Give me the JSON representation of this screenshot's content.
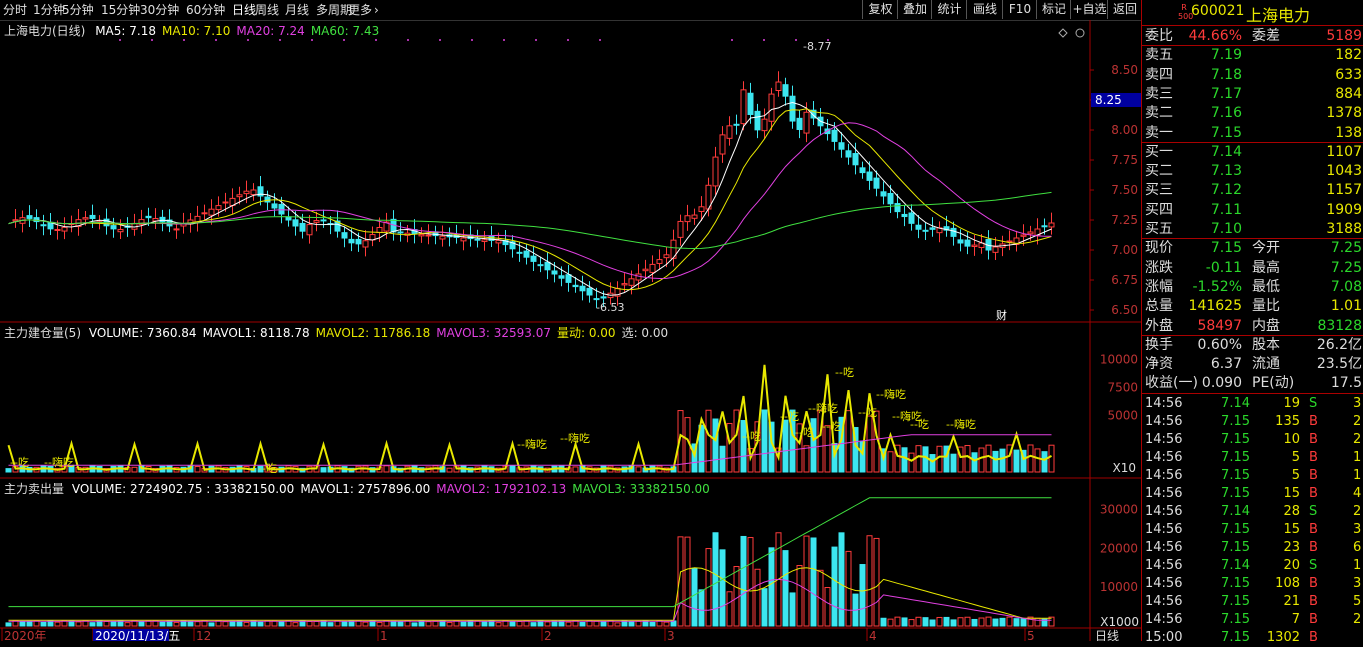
{
  "toolbar": {
    "periods": [
      "分时",
      "1分钟",
      "5分钟",
      "15分钟",
      "30分钟",
      "60分钟",
      "日线",
      "周线",
      "月线",
      "多周期",
      "更多"
    ],
    "active_period": "日线",
    "right_buttons": [
      "复权",
      "叠加",
      "统计",
      "画线",
      "F10",
      "标记",
      "+自选",
      "返回"
    ]
  },
  "stock": {
    "badge_top": "R",
    "badge_bottom": "500",
    "code": "600021",
    "name": "上海电力"
  },
  "main_chart": {
    "title": "上海电力(日线)",
    "ma": [
      {
        "label": "MA5: 7.18",
        "color": "#ffffff"
      },
      {
        "label": "MA10: 7.10",
        "color": "#e8e800"
      },
      {
        "label": "MA20: 7.24",
        "color": "#e040e0"
      },
      {
        "label": "MA60: 7.43",
        "color": "#40e040"
      }
    ],
    "high_label": "8.77",
    "low_label": "6.53",
    "current_price_tag": "8.25",
    "cai_marker": "财"
  },
  "sub1": {
    "title": "主力建仓量(5)",
    "items": [
      {
        "label": "VOLUME: 7360.84",
        "color": "#ffffff"
      },
      {
        "label": "MAVOL1: 8118.78",
        "color": "#ffffff"
      },
      {
        "label": "MAVOL2: 11786.18",
        "color": "#e8e800"
      },
      {
        "label": "MAVOL3: 32593.07",
        "color": "#e040e0"
      },
      {
        "label": "量动: 0.00",
        "color": "#e8e800"
      },
      {
        "label": "选: 0.00",
        "color": "#dddddd"
      }
    ],
    "multiplier": "X10",
    "annotations": [
      "--吃",
      "--嗨吃",
      "--吃",
      "--嗨吃",
      "--嗨吃",
      "--吃",
      "--吃",
      "--吃",
      "--嗨吃",
      "--吃",
      "--吃",
      "--吃",
      "--嗨吃",
      "--嗨吃",
      "--吃",
      "--嗨吃"
    ]
  },
  "sub2": {
    "title": "主力卖出量",
    "items": [
      {
        "label": "VOLUME: 2724902.75 : 33382150.00",
        "color": "#ffffff"
      },
      {
        "label": "MAVOL1: 2757896.00",
        "color": "#ffffff"
      },
      {
        "label": "MAVOL2: 1792102.13",
        "color": "#e040e0"
      },
      {
        "label": "MAVOL3: 33382150.00",
        "color": "#40e040"
      }
    ],
    "multiplier": "X1000"
  },
  "axis": {
    "main_ticks": [
      "8.50",
      "8.25",
      "8.00",
      "7.75",
      "7.50",
      "7.25",
      "7.00",
      "6.75",
      "6.50"
    ],
    "sub1_ticks": [
      "10000",
      "7500",
      "5000"
    ],
    "sub2_ticks": [
      "30000",
      "20000",
      "10000"
    ],
    "date_labels": [
      "2020年",
      "2020/11/13/五",
      "12",
      "1",
      "2",
      "3",
      "4",
      "5"
    ],
    "period_label": "日线"
  },
  "panel": {
    "weibi": {
      "label": "委比",
      "value": "44.66%",
      "label2": "委差",
      "value2": "5189"
    },
    "asks": [
      {
        "label": "卖五",
        "price": "7.19",
        "vol": "182"
      },
      {
        "label": "卖四",
        "price": "7.18",
        "vol": "633"
      },
      {
        "label": "卖三",
        "price": "7.17",
        "vol": "884"
      },
      {
        "label": "卖二",
        "price": "7.16",
        "vol": "1378"
      },
      {
        "label": "卖一",
        "price": "7.15",
        "vol": "138"
      }
    ],
    "bids": [
      {
        "label": "买一",
        "price": "7.14",
        "vol": "1107"
      },
      {
        "label": "买二",
        "price": "7.13",
        "vol": "1043"
      },
      {
        "label": "买三",
        "price": "7.12",
        "vol": "1157"
      },
      {
        "label": "买四",
        "price": "7.11",
        "vol": "1909"
      },
      {
        "label": "买五",
        "price": "7.10",
        "vol": "3188"
      }
    ],
    "quote": [
      {
        "l1": "现价",
        "v1": "7.15",
        "c1": "#2bd82b",
        "l2": "今开",
        "v2": "7.25",
        "c2": "#2bd82b"
      },
      {
        "l1": "涨跌",
        "v1": "-0.11",
        "c1": "#2bd82b",
        "l2": "最高",
        "v2": "7.25",
        "c2": "#2bd82b"
      },
      {
        "l1": "涨幅",
        "v1": "-1.52%",
        "c1": "#2bd82b",
        "l2": "最低",
        "v2": "7.08",
        "c2": "#2bd82b"
      },
      {
        "l1": "总量",
        "v1": "141625",
        "c1": "#e8e800",
        "l2": "量比",
        "v2": "1.01",
        "c2": "#e8e800"
      },
      {
        "l1": "外盘",
        "v1": "58497",
        "c1": "#ff3b3b",
        "l2": "内盘",
        "v2": "83128",
        "c2": "#2bd82b"
      }
    ],
    "fund": [
      {
        "l1": "换手",
        "v1": "0.60%",
        "l2": "股本",
        "v2": "26.2亿"
      },
      {
        "l1": "净资",
        "v1": "6.37",
        "l2": "流通",
        "v2": "23.5亿"
      },
      {
        "l1": "收益(一)",
        "v1": "0.090",
        "l2": "PE(动)",
        "v2": "17.5"
      }
    ],
    "ticks": [
      {
        "t": "14:56",
        "p": "7.14",
        "q": "19",
        "d": "S",
        "n": "3"
      },
      {
        "t": "14:56",
        "p": "7.15",
        "q": "135",
        "d": "B",
        "n": "2"
      },
      {
        "t": "14:56",
        "p": "7.15",
        "q": "10",
        "d": "B",
        "n": "2"
      },
      {
        "t": "14:56",
        "p": "7.15",
        "q": "5",
        "d": "B",
        "n": "1"
      },
      {
        "t": "14:56",
        "p": "7.15",
        "q": "5",
        "d": "B",
        "n": "1"
      },
      {
        "t": "14:56",
        "p": "7.15",
        "q": "15",
        "d": "B",
        "n": "4"
      },
      {
        "t": "14:56",
        "p": "7.14",
        "q": "28",
        "d": "S",
        "n": "2"
      },
      {
        "t": "14:56",
        "p": "7.15",
        "q": "15",
        "d": "B",
        "n": "3"
      },
      {
        "t": "14:56",
        "p": "7.15",
        "q": "23",
        "d": "B",
        "n": "6"
      },
      {
        "t": "14:56",
        "p": "7.14",
        "q": "20",
        "d": "S",
        "n": "1"
      },
      {
        "t": "14:56",
        "p": "7.15",
        "q": "108",
        "d": "B",
        "n": "3"
      },
      {
        "t": "14:56",
        "p": "7.15",
        "q": "21",
        "d": "B",
        "n": "5"
      },
      {
        "t": "14:56",
        "p": "7.15",
        "q": "7",
        "d": "B",
        "n": "2"
      },
      {
        "t": "15:00",
        "p": "7.15",
        "q": "1302",
        "d": "B",
        "n": ""
      }
    ]
  },
  "colors": {
    "up": "#ff3b3b",
    "down": "#3ce6f0",
    "ma5": "#ffffff",
    "ma10": "#e8e800",
    "ma20": "#e040e0",
    "ma60": "#40e040",
    "grid": "#8b0000",
    "border": "#a00000"
  }
}
